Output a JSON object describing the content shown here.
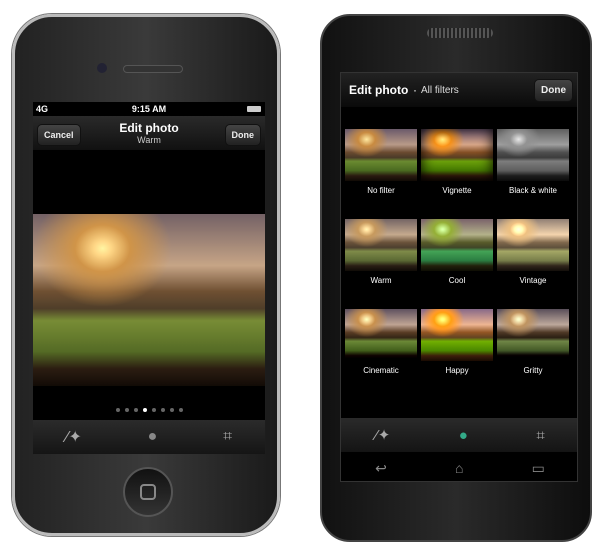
{
  "iphone": {
    "status": {
      "signal": "4G",
      "time": "9:15 AM"
    },
    "nav": {
      "cancel": "Cancel",
      "title": "Edit photo",
      "subtitle": "Warm",
      "done": "Done"
    },
    "page_dots": {
      "count": 8,
      "active": 4
    },
    "toolbar": [
      "magic-wand-icon",
      "filters-icon",
      "crop-icon"
    ]
  },
  "android": {
    "header": {
      "title": "Edit photo",
      "separator": "·",
      "subtitle": "All filters",
      "done": "Done"
    },
    "filters": [
      "No filter",
      "Vignette",
      "Black & white",
      "Warm",
      "Cool",
      "Vintage",
      "Cinematic",
      "Happy",
      "Gritty"
    ],
    "toolbar": [
      "magic-wand-icon",
      "filters-icon",
      "crop-icon"
    ],
    "navbar": [
      "back-icon",
      "home-icon",
      "recent-apps-icon"
    ]
  }
}
